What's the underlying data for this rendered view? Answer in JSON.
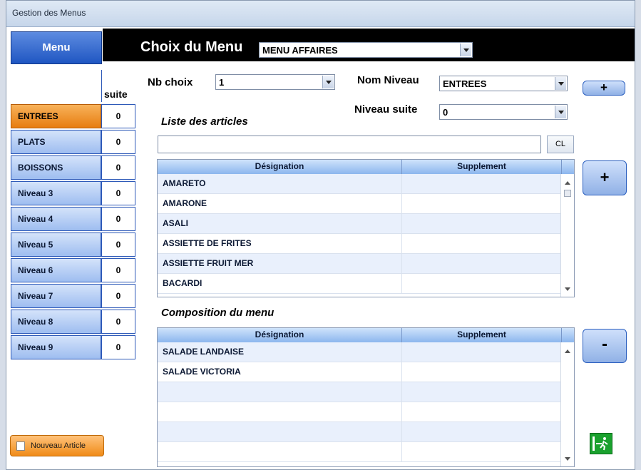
{
  "window": {
    "title": "Gestion des Menus"
  },
  "sidebar": {
    "header": "Menu",
    "suite_label": "suite",
    "levels": [
      {
        "label": "ENTREES",
        "count": "0",
        "active": true
      },
      {
        "label": "PLATS",
        "count": "0"
      },
      {
        "label": "BOISSONS",
        "count": "0"
      },
      {
        "label": "Niveau 3",
        "count": "0"
      },
      {
        "label": "Niveau 4",
        "count": "0"
      },
      {
        "label": "Niveau 5",
        "count": "0"
      },
      {
        "label": "Niveau 6",
        "count": "0"
      },
      {
        "label": "Niveau 7",
        "count": "0"
      },
      {
        "label": "Niveau 8",
        "count": "0"
      },
      {
        "label": "Niveau 9",
        "count": "0"
      }
    ],
    "new_article_label": "Nouveau Article"
  },
  "header": {
    "choice_label": "Choix du Menu",
    "menu_value": "MENU AFFAIRES"
  },
  "form": {
    "nb_choix_label": "Nb choix",
    "nb_choix_value": "1",
    "nom_niveau_label": "Nom Niveau",
    "nom_niveau_value": "ENTREES",
    "niveau_suite_label": "Niveau suite",
    "niveau_suite_value": "0",
    "plus_label": "+",
    "minus_label": "-",
    "cl_label": "CL",
    "search_value": ""
  },
  "articles": {
    "title": "Liste des articles",
    "columns": [
      "Désignation",
      "Supplement"
    ],
    "rows": [
      "AMARETO",
      "AMARONE",
      "ASALI",
      "ASSIETTE DE FRITES",
      "ASSIETTE FRUIT MER",
      "BACARDI"
    ]
  },
  "composition": {
    "title": "Composition du menu",
    "columns": [
      "Désignation",
      "Supplement"
    ],
    "rows": [
      "SALADE LANDAISE",
      "SALADE VICTORIA",
      "",
      "",
      "",
      ""
    ]
  },
  "colors": {
    "active_level": "#e77d10",
    "level": "#9ebdf0",
    "header_bar": "#000000",
    "exit_icon": "#1aa12e"
  }
}
